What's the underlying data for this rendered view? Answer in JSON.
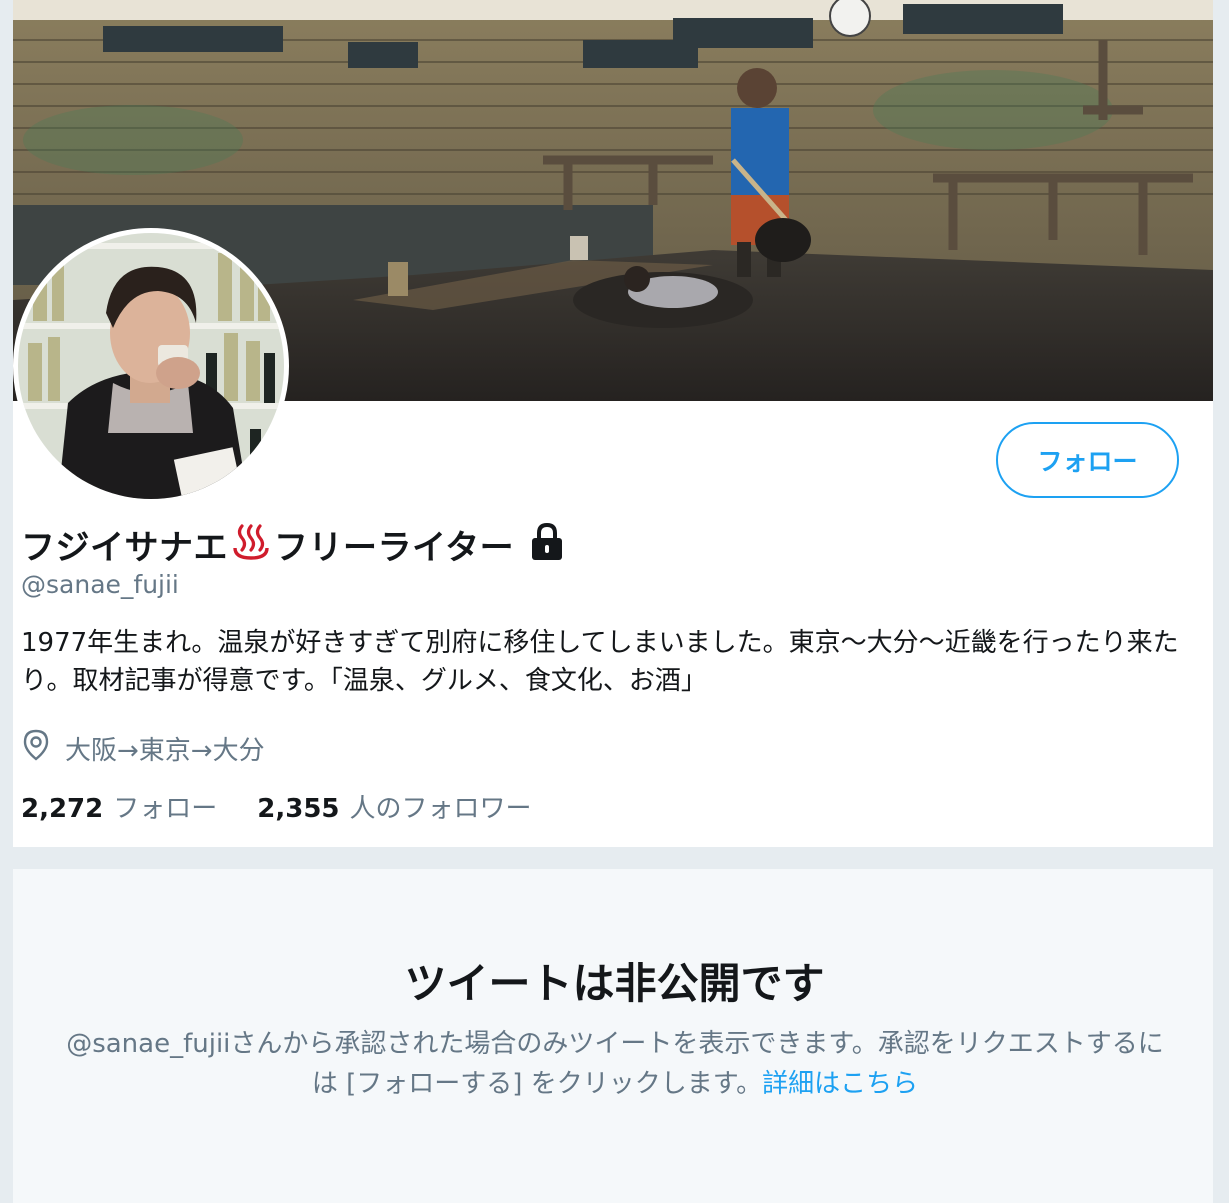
{
  "profile": {
    "name": "フジイサナエ",
    "name_suffix": "フリーライター",
    "name_emoji": "onsen-icon",
    "lock_icon": "lock-icon",
    "handle": "@sanae_fujii",
    "bio": "1977年生まれ。温泉が好きすぎて別府に移住してしまいました。東京〜大分〜近畿を行ったり来たり。取材記事が得意です。「温泉、グルメ、食文化、お酒」",
    "location_icon": "location-pin-icon",
    "location": "大阪→東京→大分",
    "following_count": "2,272",
    "following_label": "フォロー",
    "followers_count": "2,355",
    "followers_label": "人のフォロワー",
    "follow_button_label": "フォロー"
  },
  "private_notice": {
    "title": "ツイートは非公開です",
    "description": "@sanae_fujiiさんから承認された場合のみツイートを表示できます。承認をリクエストするには [フォローする] をクリックします。",
    "link_label": "詳細はこちら"
  },
  "colors": {
    "accent": "#1da1f2",
    "secondary_text": "#657786",
    "page_background": "#e6ecf0"
  }
}
